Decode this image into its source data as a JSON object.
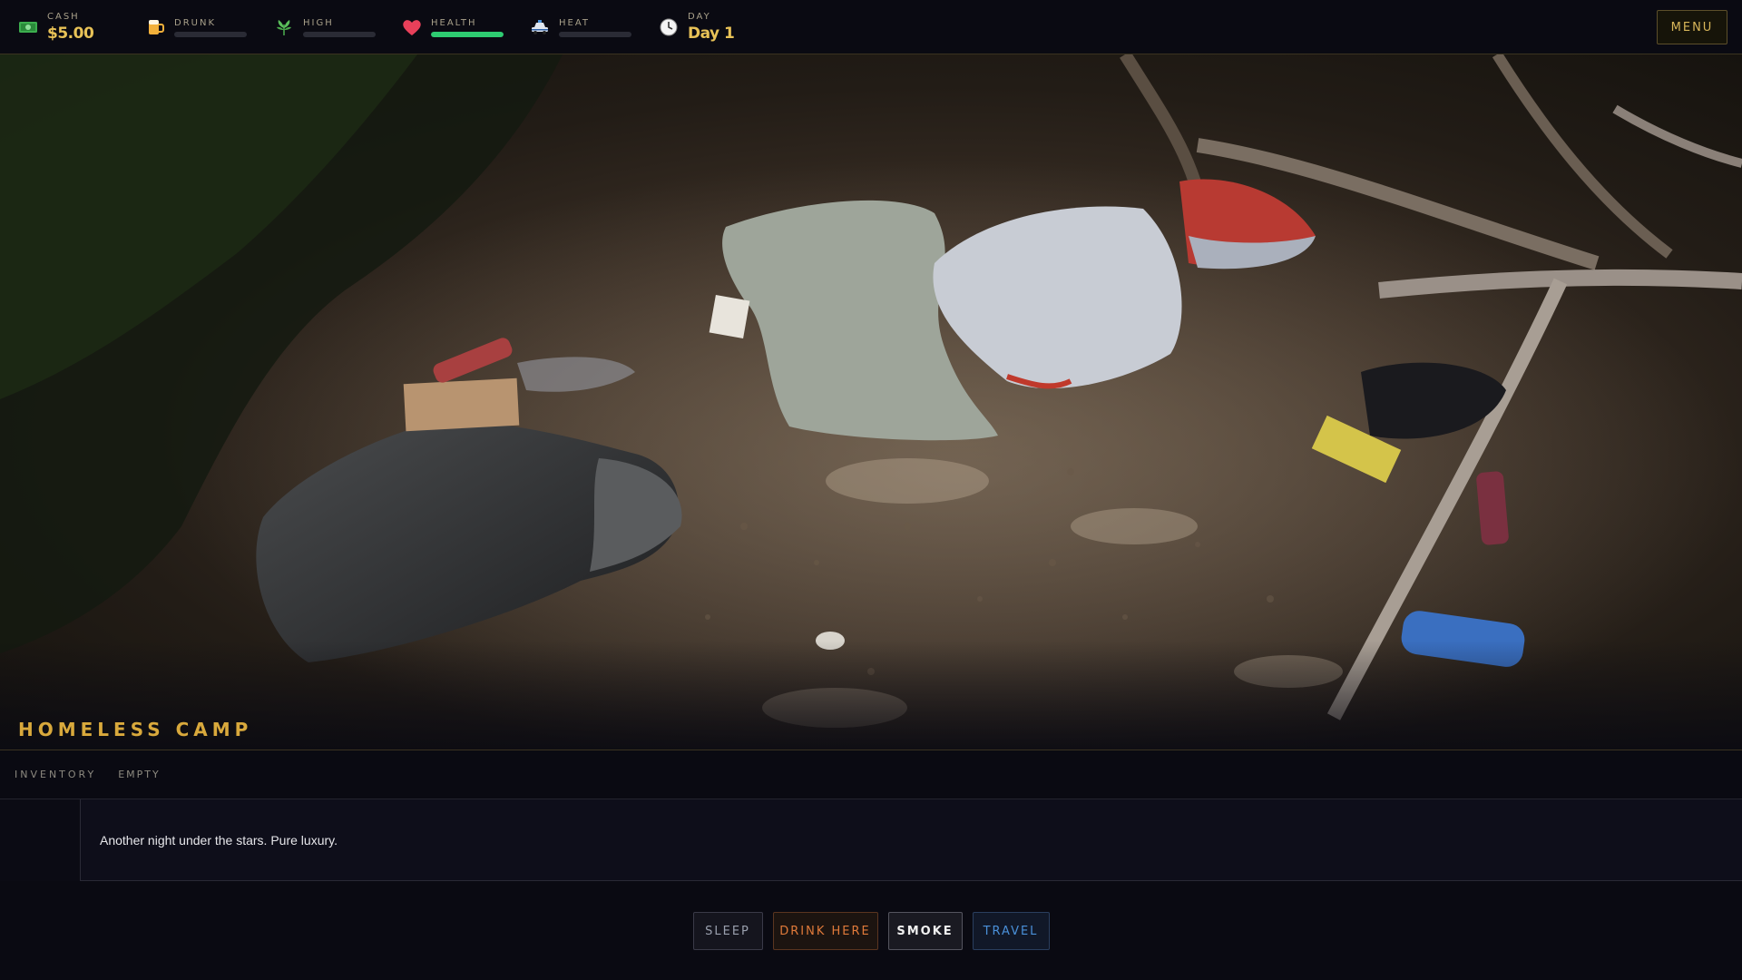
{
  "hud": {
    "cash": {
      "label": "CASH",
      "value": "$5.00",
      "icon": "cash-icon"
    },
    "drunk": {
      "label": "DRUNK",
      "level": 0,
      "icon": "beer-icon"
    },
    "high": {
      "label": "HIGH",
      "level": 0,
      "icon": "leaf-icon"
    },
    "health": {
      "label": "HEALTH",
      "level": 1.0,
      "icon": "heart-icon",
      "color": "#2ecc71"
    },
    "heat": {
      "label": "HEAT",
      "level": 0,
      "icon": "police-car-icon"
    },
    "day": {
      "label": "DAY",
      "value": "Day 1",
      "icon": "clock-icon"
    },
    "menu_label": "MENU"
  },
  "scene": {
    "location": "HOMELESS CAMP"
  },
  "inventory": {
    "label": "INVENTORY",
    "empty_text": "EMPTY"
  },
  "message": {
    "text": "Another night under the stars. Pure luxury."
  },
  "actions": {
    "sleep": "SLEEP",
    "drink": "DRINK HERE",
    "smoke": "SMOKE",
    "travel": "TRAVEL"
  },
  "colors": {
    "accent_gold": "#e8c257",
    "health_green": "#2ecc71",
    "drink_orange": "#e07a3a",
    "travel_blue": "#4a90d9"
  }
}
